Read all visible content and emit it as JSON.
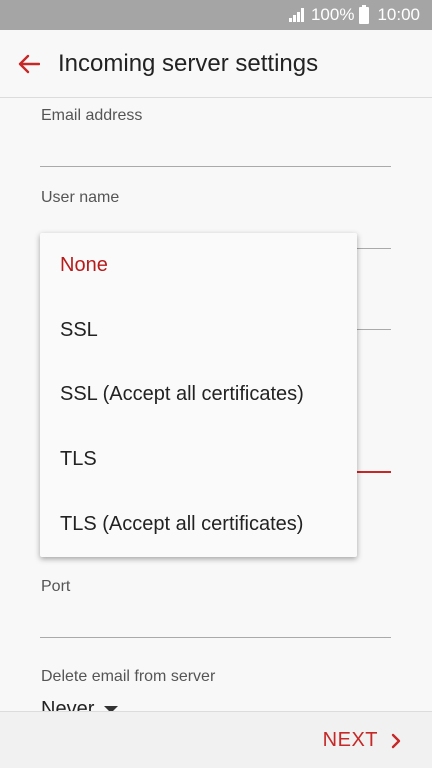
{
  "status_bar": {
    "battery": "100%",
    "time": "10:00"
  },
  "app_bar": {
    "title": "Incoming server settings"
  },
  "form": {
    "email_label": "Email address",
    "username_label": "User name",
    "port_label": "Port",
    "delete_label": "Delete email from server",
    "delete_value": "Never"
  },
  "security_dropdown": {
    "options": [
      "None",
      "SSL",
      "SSL (Accept all certificates)",
      "TLS",
      "TLS (Accept all certificates)"
    ],
    "selected": "None"
  },
  "footer": {
    "next_label": "NEXT"
  },
  "colors": {
    "accent": "#c62828",
    "selected": "#b71c1c",
    "status_bar": "#a5a5a5"
  }
}
